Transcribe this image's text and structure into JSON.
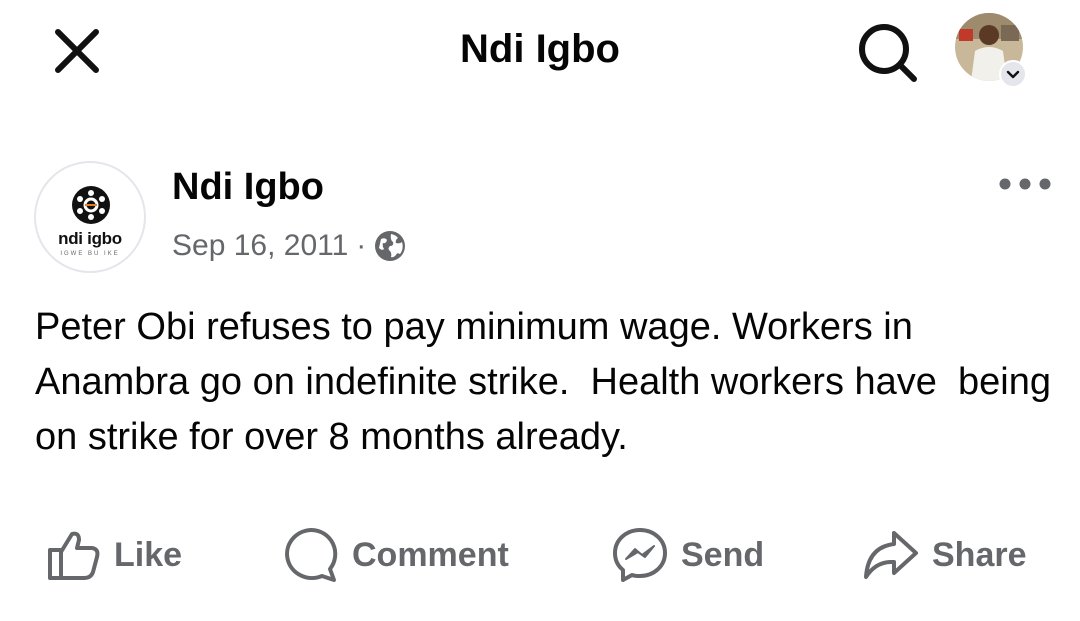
{
  "header": {
    "title": "Ndi Igbo",
    "close_icon": "close-icon",
    "search_icon": "search-icon"
  },
  "post": {
    "avatar": {
      "logo_text": "ndi igbo",
      "tagline": "IGWE BU IKE"
    },
    "author": "Ndi Igbo",
    "date": "Sep 16, 2011",
    "separator": "·",
    "privacy_icon": "globe-icon",
    "text": "Peter Obi refuses to pay minimum wage. Workers in Anambra go on indefinite strike.  Health workers have  being on strike for over 8 months already."
  },
  "actions": {
    "like": "Like",
    "comment": "Comment",
    "send": "Send",
    "share": "Share"
  },
  "colors": {
    "text": "#050505",
    "secondary": "#65676b",
    "divider": "#e4e6eb"
  }
}
